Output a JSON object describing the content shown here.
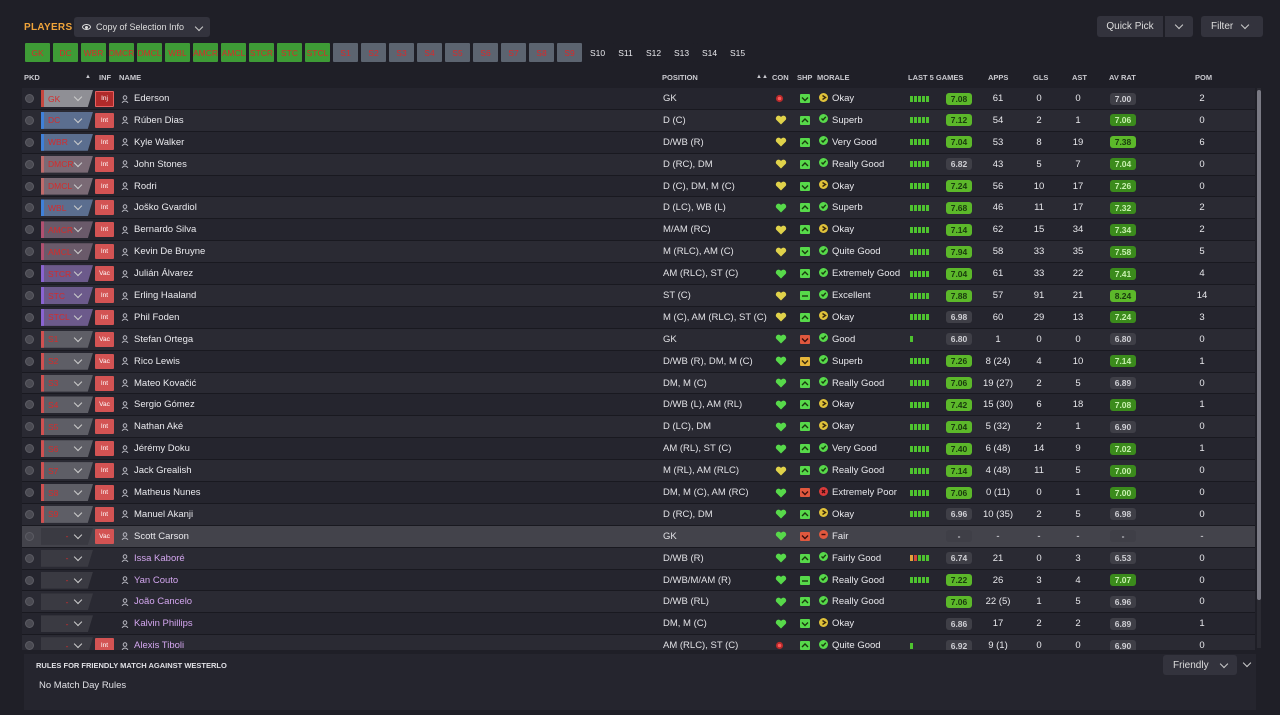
{
  "header": {
    "title": "PLAYERS",
    "view_label": "Copy of Selection Info",
    "quick_pick": "Quick Pick",
    "filter": "Filter"
  },
  "slots": [
    {
      "label": "GK",
      "color": "#3e9b36"
    },
    {
      "label": "DC",
      "color": "#3e9b36"
    },
    {
      "label": "WBR",
      "color": "#3e9b36"
    },
    {
      "label": "DMCR",
      "color": "#3e9b36"
    },
    {
      "label": "DMCL",
      "color": "#3e9b36"
    },
    {
      "label": "WBL",
      "color": "#3e9b36"
    },
    {
      "label": "AMCR",
      "color": "#3e9b36"
    },
    {
      "label": "AMCL",
      "color": "#3e9b36"
    },
    {
      "label": "STCR",
      "color": "#3e9b36"
    },
    {
      "label": "STC",
      "color": "#3e9b36"
    },
    {
      "label": "STCL",
      "color": "#3e9b36"
    },
    {
      "label": "S1",
      "color": "#5c6470"
    },
    {
      "label": "S2",
      "color": "#5c6470"
    },
    {
      "label": "S3",
      "color": "#5c6470"
    },
    {
      "label": "S4",
      "color": "#5c6470"
    },
    {
      "label": "S5",
      "color": "#5c6470"
    },
    {
      "label": "S6",
      "color": "#5c6470"
    },
    {
      "label": "S7",
      "color": "#5c6470"
    },
    {
      "label": "S8",
      "color": "#5c6470"
    },
    {
      "label": "S9",
      "color": "#5c6470"
    },
    {
      "label": "S10",
      "color": "empty"
    },
    {
      "label": "S11",
      "color": "empty"
    },
    {
      "label": "S12",
      "color": "empty"
    },
    {
      "label": "S13",
      "color": "empty"
    },
    {
      "label": "S14",
      "color": "empty"
    },
    {
      "label": "S15",
      "color": "empty"
    }
  ],
  "columns": {
    "pkd": "PKD",
    "inf": "INF",
    "name": "NAME",
    "position": "POSITION",
    "con": "CON",
    "shp": "SHP",
    "morale": "MORALE",
    "last5": "LAST 5 GAMES",
    "apps": "APPS",
    "gls": "GLS",
    "ast": "AST",
    "avrat": "AV RAT",
    "pom": "POM"
  },
  "players": [
    {
      "slot": "GK",
      "slot_style": "gk",
      "inf": "Inj",
      "name": "Ederson",
      "position": "GK",
      "con": "red",
      "shp": "down",
      "morale": "Okay",
      "mood": "okay",
      "last5": [
        "g",
        "g",
        "g",
        "g",
        "g"
      ],
      "l5rating": "7.08",
      "l5_level": "hi",
      "apps": "61",
      "gls": "0",
      "ast": "0",
      "avrat": "7.00",
      "av_level": "gr",
      "pom": "2",
      "reserve": false
    },
    {
      "slot": "DC",
      "slot_style": "d",
      "inf": "Int",
      "name": "Rúben Dias",
      "position": "D (C)",
      "con": "yellow",
      "shp": "up",
      "morale": "Superb",
      "mood": "superb",
      "last5": [
        "g",
        "g",
        "g",
        "g",
        "g"
      ],
      "l5rating": "7.12",
      "l5_level": "hi",
      "apps": "54",
      "gls": "2",
      "ast": "1",
      "avrat": "7.06",
      "av_level": "md",
      "pom": "0",
      "reserve": false
    },
    {
      "slot": "WBR",
      "slot_style": "d",
      "inf": "Int",
      "name": "Kyle Walker",
      "position": "D/WB (R)",
      "con": "yellow",
      "shp": "up",
      "morale": "Very Good",
      "mood": "good",
      "last5": [
        "g",
        "g",
        "g",
        "g",
        "g"
      ],
      "l5rating": "7.04",
      "l5_level": "hi",
      "apps": "53",
      "gls": "8",
      "ast": "19",
      "avrat": "7.38",
      "av_level": "hi",
      "pom": "6",
      "reserve": false
    },
    {
      "slot": "DMCR",
      "slot_style": "dm",
      "inf": "Int",
      "name": "John Stones",
      "position": "D (RC), DM",
      "con": "yellow",
      "shp": "up",
      "morale": "Really Good",
      "mood": "good",
      "last5": [
        "g",
        "g",
        "g",
        "g",
        "g"
      ],
      "l5rating": "6.82",
      "l5_level": "gr",
      "apps": "43",
      "gls": "5",
      "ast": "7",
      "avrat": "7.04",
      "av_level": "md",
      "pom": "0",
      "reserve": false
    },
    {
      "slot": "DMCL",
      "slot_style": "dm",
      "inf": "Int",
      "name": "Rodri",
      "position": "D (C), DM, M (C)",
      "con": "yellow",
      "shp": "down",
      "morale": "Okay",
      "mood": "okay",
      "last5": [
        "g",
        "g",
        "g",
        "g",
        "g"
      ],
      "l5rating": "7.24",
      "l5_level": "hi",
      "apps": "56",
      "gls": "10",
      "ast": "17",
      "avrat": "7.26",
      "av_level": "md",
      "pom": "0",
      "reserve": false
    },
    {
      "slot": "WBL",
      "slot_style": "d",
      "inf": "Int",
      "name": "Joško Gvardiol",
      "position": "D (LC), WB (L)",
      "con": "green",
      "shp": "up",
      "morale": "Superb",
      "mood": "superb",
      "last5": [
        "g",
        "g",
        "g",
        "g",
        "g"
      ],
      "l5rating": "7.68",
      "l5_level": "hi",
      "apps": "46",
      "gls": "11",
      "ast": "17",
      "avrat": "7.32",
      "av_level": "md",
      "pom": "2",
      "reserve": false
    },
    {
      "slot": "AMCR",
      "slot_style": "am",
      "inf": "Int",
      "name": "Bernardo Silva",
      "position": "M/AM (RC)",
      "con": "yellow",
      "shp": "up",
      "morale": "Okay",
      "mood": "okay",
      "last5": [
        "g",
        "g",
        "g",
        "g",
        "g"
      ],
      "l5rating": "7.14",
      "l5_level": "hi",
      "apps": "62",
      "gls": "15",
      "ast": "34",
      "avrat": "7.34",
      "av_level": "md",
      "pom": "2",
      "reserve": false
    },
    {
      "slot": "AMCL",
      "slot_style": "am",
      "inf": "Int",
      "name": "Kevin De Bruyne",
      "position": "M (RLC), AM (C)",
      "con": "yellow",
      "shp": "down",
      "morale": "Quite Good",
      "mood": "good",
      "last5": [
        "g",
        "g",
        "g",
        "g",
        "g"
      ],
      "l5rating": "7.94",
      "l5_level": "hi",
      "apps": "58",
      "gls": "33",
      "ast": "35",
      "avrat": "7.58",
      "av_level": "md",
      "pom": "5",
      "reserve": false
    },
    {
      "slot": "STCR",
      "slot_style": "st",
      "inf": "Vac",
      "name": "Julián Álvarez",
      "position": "AM (RLC), ST (C)",
      "con": "green",
      "shp": "up",
      "morale": "Extremely Good",
      "mood": "superb",
      "last5": [
        "g",
        "g",
        "g",
        "g",
        "g"
      ],
      "l5rating": "7.04",
      "l5_level": "hi",
      "apps": "61",
      "gls": "33",
      "ast": "22",
      "avrat": "7.41",
      "av_level": "md",
      "pom": "4",
      "reserve": false
    },
    {
      "slot": "STC",
      "slot_style": "st",
      "inf": "Int",
      "name": "Erling Haaland",
      "position": "ST (C)",
      "con": "yellow",
      "shp": "flat",
      "morale": "Excellent",
      "mood": "superb",
      "last5": [
        "g",
        "g",
        "g",
        "g",
        "g"
      ],
      "l5rating": "7.88",
      "l5_level": "hi",
      "apps": "57",
      "gls": "91",
      "ast": "21",
      "avrat": "8.24",
      "av_level": "hi",
      "pom": "14",
      "reserve": false
    },
    {
      "slot": "STCL",
      "slot_style": "st",
      "inf": "Int",
      "name": "Phil Foden",
      "position": "M (C), AM (RLC), ST (C)",
      "con": "yellow",
      "shp": "up",
      "morale": "Okay",
      "mood": "okay",
      "last5": [
        "g",
        "g",
        "g",
        "g",
        "g"
      ],
      "l5rating": "6.98",
      "l5_level": "gr",
      "apps": "60",
      "gls": "29",
      "ast": "13",
      "avrat": "7.24",
      "av_level": "md",
      "pom": "3",
      "reserve": false
    },
    {
      "slot": "S1",
      "slot_style": "sub",
      "inf": "Vac",
      "name": "Stefan Ortega",
      "position": "GK",
      "con": "green",
      "shp": "red",
      "morale": "Good",
      "mood": "good",
      "last5": [
        "g"
      ],
      "l5rating": "6.80",
      "l5_level": "gr",
      "apps": "1",
      "gls": "0",
      "ast": "0",
      "avrat": "6.80",
      "av_level": "gr",
      "pom": "0",
      "reserve": false
    },
    {
      "slot": "S2",
      "slot_style": "sub",
      "inf": "Vac",
      "name": "Rico Lewis",
      "position": "D/WB (R), DM, M (C)",
      "con": "green",
      "shp": "orange",
      "morale": "Superb",
      "mood": "superb",
      "last5": [
        "g",
        "g",
        "g",
        "g",
        "g"
      ],
      "l5rating": "7.26",
      "l5_level": "hi",
      "apps": "8 (24)",
      "gls": "4",
      "ast": "10",
      "avrat": "7.14",
      "av_level": "md",
      "pom": "1",
      "reserve": false
    },
    {
      "slot": "S3",
      "slot_style": "sub",
      "inf": "Int",
      "name": "Mateo Kovačić",
      "position": "DM, M (C)",
      "con": "green",
      "shp": "up",
      "morale": "Really Good",
      "mood": "good",
      "last5": [
        "g",
        "g",
        "g",
        "g",
        "g"
      ],
      "l5rating": "7.06",
      "l5_level": "hi",
      "apps": "19 (27)",
      "gls": "2",
      "ast": "5",
      "avrat": "6.89",
      "av_level": "gr",
      "pom": "0",
      "reserve": false
    },
    {
      "slot": "S4",
      "slot_style": "sub",
      "inf": "Vac",
      "name": "Sergio Gómez",
      "position": "D/WB (L), AM (RL)",
      "con": "green",
      "shp": "up",
      "morale": "Okay",
      "mood": "okay",
      "last5": [
        "g",
        "g",
        "g",
        "g",
        "g"
      ],
      "l5rating": "7.42",
      "l5_level": "hi",
      "apps": "15 (30)",
      "gls": "6",
      "ast": "18",
      "avrat": "7.08",
      "av_level": "md",
      "pom": "1",
      "reserve": false
    },
    {
      "slot": "S5",
      "slot_style": "sub",
      "inf": "Int",
      "name": "Nathan Aké",
      "position": "D (LC), DM",
      "con": "green",
      "shp": "up",
      "morale": "Okay",
      "mood": "okay",
      "last5": [
        "g",
        "g",
        "g",
        "g",
        "g"
      ],
      "l5rating": "7.04",
      "l5_level": "hi",
      "apps": "5 (32)",
      "gls": "2",
      "ast": "1",
      "avrat": "6.90",
      "av_level": "gr",
      "pom": "0",
      "reserve": false
    },
    {
      "slot": "S6",
      "slot_style": "sub",
      "inf": "Int",
      "name": "Jérémy Doku",
      "position": "AM (RL), ST (C)",
      "con": "green",
      "shp": "up",
      "morale": "Very Good",
      "mood": "good",
      "last5": [
        "g",
        "g",
        "g",
        "g",
        "g"
      ],
      "l5rating": "7.40",
      "l5_level": "hi",
      "apps": "6 (48)",
      "gls": "14",
      "ast": "9",
      "avrat": "7.02",
      "av_level": "md",
      "pom": "1",
      "reserve": false
    },
    {
      "slot": "S7",
      "slot_style": "sub",
      "inf": "Int",
      "name": "Jack Grealish",
      "position": "M (RL), AM (RLC)",
      "con": "yellow",
      "shp": "up",
      "morale": "Really Good",
      "mood": "good",
      "last5": [
        "g",
        "g",
        "g",
        "g",
        "g"
      ],
      "l5rating": "7.14",
      "l5_level": "hi",
      "apps": "4 (48)",
      "gls": "11",
      "ast": "5",
      "avrat": "7.00",
      "av_level": "md",
      "pom": "0",
      "reserve": false
    },
    {
      "slot": "S8",
      "slot_style": "sub",
      "inf": "Int",
      "name": "Matheus Nunes",
      "position": "DM, M (C), AM (RC)",
      "con": "green",
      "shp": "red",
      "morale": "Extremely Poor",
      "mood": "poor",
      "last5": [
        "g",
        "g",
        "g",
        "g",
        "g"
      ],
      "l5rating": "7.06",
      "l5_level": "hi",
      "apps": "0 (11)",
      "gls": "0",
      "ast": "1",
      "avrat": "7.00",
      "av_level": "md",
      "pom": "0",
      "reserve": false
    },
    {
      "slot": "S9",
      "slot_style": "sub",
      "inf": "Int",
      "name": "Manuel Akanji",
      "position": "D (RC), DM",
      "con": "green",
      "shp": "up",
      "morale": "Okay",
      "mood": "okay",
      "last5": [
        "g",
        "g",
        "g",
        "g",
        "g"
      ],
      "l5rating": "6.96",
      "l5_level": "gr",
      "apps": "10 (35)",
      "gls": "2",
      "ast": "5",
      "avrat": "6.98",
      "av_level": "gr",
      "pom": "0",
      "reserve": false
    },
    {
      "slot": "-",
      "slot_style": "res",
      "inf": "Vac",
      "name": "Scott Carson",
      "position": "GK",
      "con": "green",
      "shp": "red",
      "morale": "Fair",
      "mood": "fair",
      "last5": [],
      "l5rating": "-",
      "l5_level": "gr",
      "apps": "-",
      "gls": "-",
      "ast": "-",
      "avrat": "-",
      "av_level": "gr",
      "pom": "-",
      "reserve": false,
      "selected": true
    },
    {
      "slot": "-",
      "slot_style": "res",
      "inf": "",
      "name": "Issa Kaboré",
      "position": "D/WB (R)",
      "con": "green",
      "shp": "up",
      "morale": "Fairly Good",
      "mood": "good",
      "last5": [
        "o",
        "r",
        "g",
        "g",
        "g"
      ],
      "l5rating": "6.74",
      "l5_level": "gr",
      "apps": "21",
      "gls": "0",
      "ast": "3",
      "avrat": "6.53",
      "av_level": "gr",
      "pom": "0",
      "reserve": true
    },
    {
      "slot": "-",
      "slot_style": "res",
      "inf": "",
      "name": "Yan Couto",
      "position": "D/WB/M/AM (R)",
      "con": "green",
      "shp": "flat",
      "morale": "Really Good",
      "mood": "good",
      "last5": [
        "g",
        "g",
        "g",
        "g",
        "g"
      ],
      "l5rating": "7.22",
      "l5_level": "hi",
      "apps": "26",
      "gls": "3",
      "ast": "4",
      "avrat": "7.07",
      "av_level": "md",
      "pom": "0",
      "reserve": true
    },
    {
      "slot": "-",
      "slot_style": "res",
      "inf": "",
      "name": "João Cancelo",
      "position": "D/WB (RL)",
      "con": "green",
      "shp": "up",
      "morale": "Really Good",
      "mood": "good",
      "last5": [],
      "l5rating": "7.06",
      "l5_level": "hi",
      "apps": "22 (5)",
      "gls": "1",
      "ast": "5",
      "avrat": "6.96",
      "av_level": "gr",
      "pom": "0",
      "reserve": true
    },
    {
      "slot": "-",
      "slot_style": "res",
      "inf": "",
      "name": "Kalvin Phillips",
      "position": "DM, M (C)",
      "con": "green",
      "shp": "down",
      "morale": "Okay",
      "mood": "okay",
      "last5": [],
      "l5rating": "6.86",
      "l5_level": "gr",
      "apps": "17",
      "gls": "2",
      "ast": "2",
      "avrat": "6.89",
      "av_level": "gr",
      "pom": "1",
      "reserve": true
    },
    {
      "slot": "-",
      "slot_style": "res",
      "inf": "Int",
      "name": "Alexis Tiboli",
      "position": "AM (RLC), ST (C)",
      "con": "red",
      "shp": "up",
      "morale": "Quite Good",
      "mood": "good",
      "last5": [
        "g"
      ],
      "l5rating": "6.92",
      "l5_level": "gr",
      "apps": "9 (1)",
      "gls": "0",
      "ast": "0",
      "avrat": "6.90",
      "av_level": "gr",
      "pom": "0",
      "reserve": true
    }
  ],
  "rules": {
    "title": "RULES FOR FRIENDLY MATCH AGAINST WESTERLO",
    "value": "No Match Day Rules",
    "select": "Friendly"
  },
  "colors": {
    "accent": "#f0a43a",
    "bar_green": "#4ec32f",
    "rating_high": "#5cb82a",
    "rating_mid": "#3b8b1c"
  }
}
